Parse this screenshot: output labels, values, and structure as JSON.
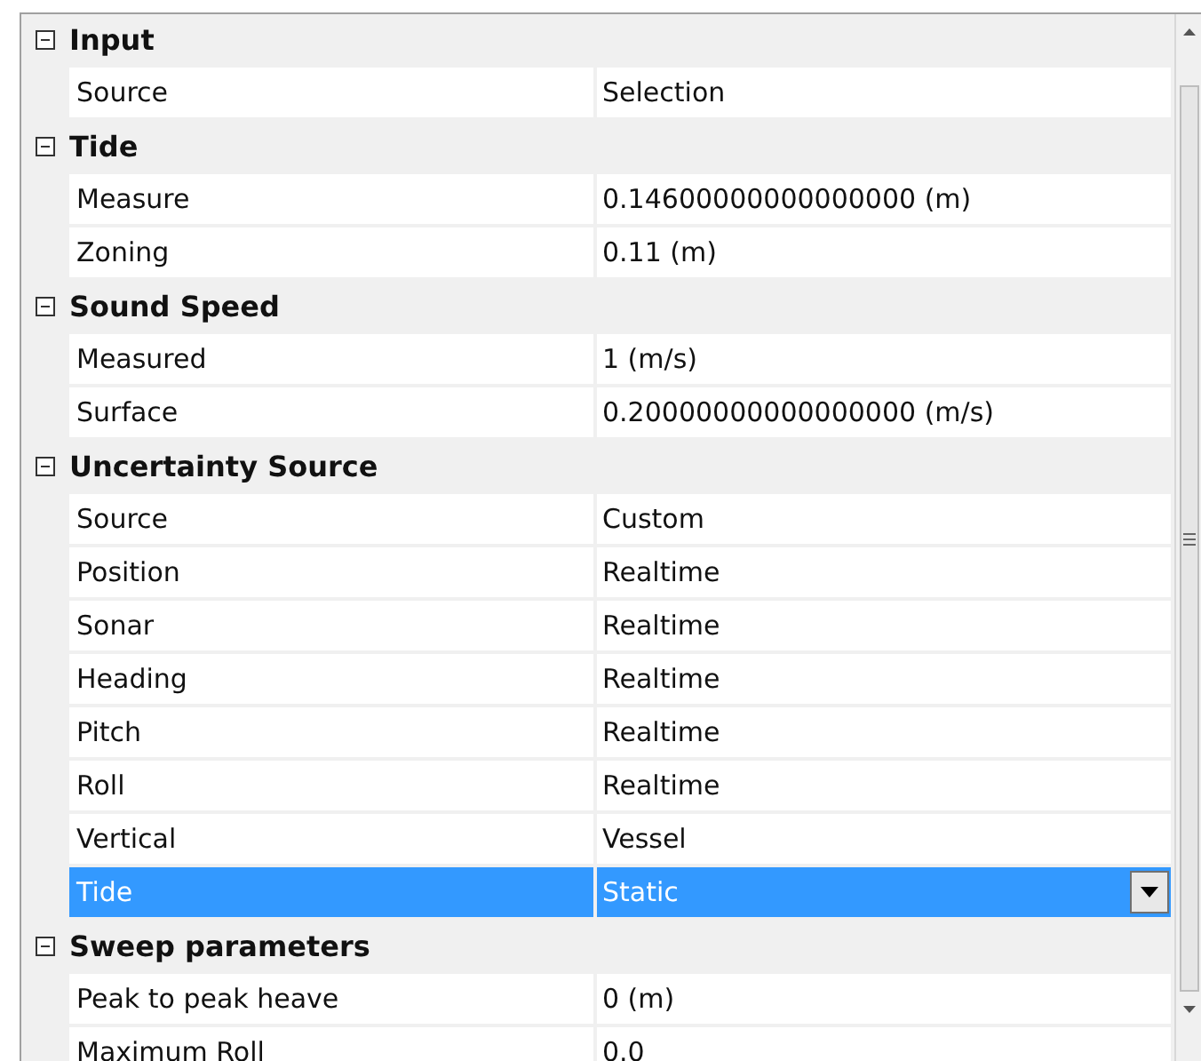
{
  "categories": [
    {
      "title": "Input",
      "expanded": true,
      "properties": [
        {
          "name": "Source",
          "value": "Selection",
          "selected": false
        }
      ]
    },
    {
      "title": "Tide",
      "expanded": true,
      "properties": [
        {
          "name": "Measure",
          "value": "0.14600000000000000 (m)",
          "selected": false
        },
        {
          "name": "Zoning",
          "value": "0.11 (m)",
          "selected": false
        }
      ]
    },
    {
      "title": "Sound Speed",
      "expanded": true,
      "properties": [
        {
          "name": "Measured",
          "value": "1 (m/s)",
          "selected": false
        },
        {
          "name": "Surface",
          "value": "0.20000000000000000 (m/s)",
          "selected": false
        }
      ]
    },
    {
      "title": "Uncertainty Source",
      "expanded": true,
      "properties": [
        {
          "name": "Source",
          "value": "Custom",
          "selected": false
        },
        {
          "name": "Position",
          "value": "Realtime",
          "selected": false
        },
        {
          "name": "Sonar",
          "value": "Realtime",
          "selected": false
        },
        {
          "name": "Heading",
          "value": "Realtime",
          "selected": false
        },
        {
          "name": "Pitch",
          "value": "Realtime",
          "selected": false
        },
        {
          "name": "Roll",
          "value": "Realtime",
          "selected": false
        },
        {
          "name": "Vertical",
          "value": "Vessel",
          "selected": false
        },
        {
          "name": "Tide",
          "value": "Static",
          "selected": true,
          "kind": "dropdown"
        }
      ]
    },
    {
      "title": "Sweep parameters",
      "expanded": true,
      "properties": [
        {
          "name": "Peak to peak heave",
          "value": "0 (m)",
          "selected": false
        },
        {
          "name": "Maximum Roll",
          "value": "0.0",
          "selected": false
        }
      ]
    }
  ]
}
